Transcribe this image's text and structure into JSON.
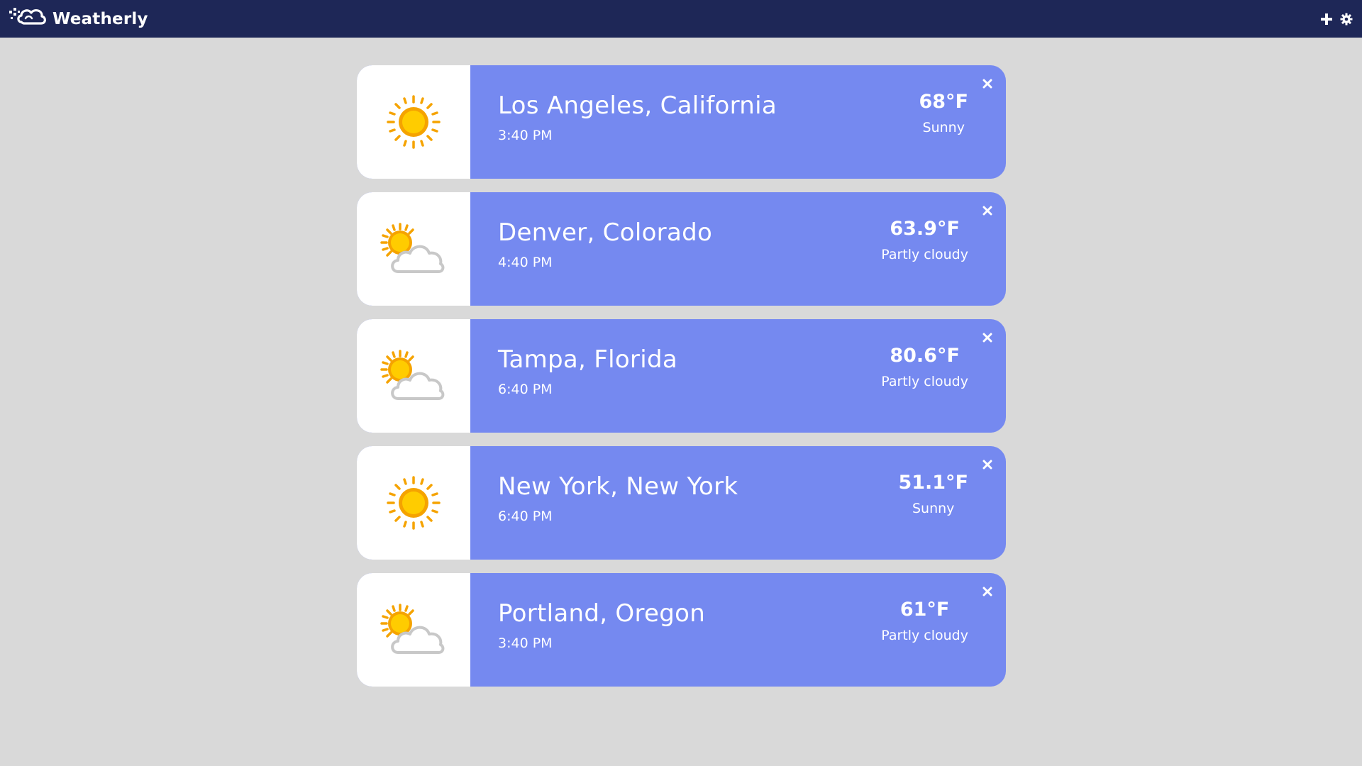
{
  "app": {
    "name": "Weatherly"
  },
  "toolbar": {
    "add_icon": "plus-icon",
    "settings_icon": "gear-icon"
  },
  "colors": {
    "topbar": "#1e2757",
    "card": "#7589f0",
    "background": "#d9d9d9",
    "sun": "#ffcc00",
    "sun_rays": "#f5a300",
    "cloud": "#ffffff"
  },
  "cities": [
    {
      "name": "Los Angeles, California",
      "time": "3:40 PM",
      "temp": "68°F",
      "condition": "Sunny",
      "icon": "sun-icon"
    },
    {
      "name": "Denver, Colorado",
      "time": "4:40 PM",
      "temp": "63.9°F",
      "condition": "Partly cloudy",
      "icon": "partly-cloudy-icon"
    },
    {
      "name": "Tampa, Florida",
      "time": "6:40 PM",
      "temp": "80.6°F",
      "condition": "Partly cloudy",
      "icon": "partly-cloudy-icon"
    },
    {
      "name": "New York, New York",
      "time": "6:40 PM",
      "temp": "51.1°F",
      "condition": "Sunny",
      "icon": "sun-icon"
    },
    {
      "name": "Portland, Oregon",
      "time": "3:40 PM",
      "temp": "61°F",
      "condition": "Partly cloudy",
      "icon": "partly-cloudy-icon"
    }
  ]
}
